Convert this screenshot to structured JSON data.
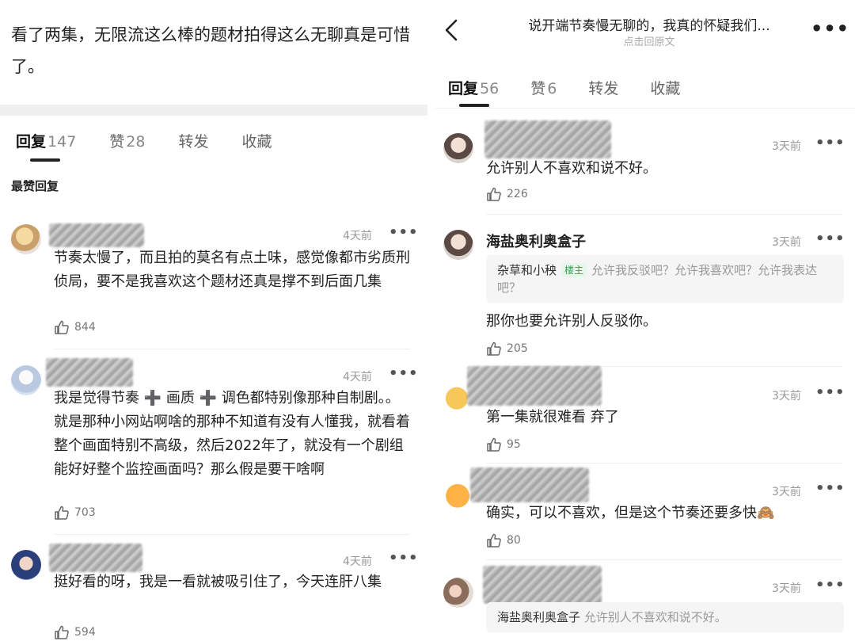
{
  "left": {
    "post_text": "看了两集，无限流这么棒的题材拍得这么无聊真是可惜了。",
    "tabs": [
      {
        "label": "回复",
        "count": "147"
      },
      {
        "label": "赞",
        "count": "28"
      },
      {
        "label": "转发",
        "count": ""
      },
      {
        "label": "收藏",
        "count": ""
      }
    ],
    "section_label": "最赞回复",
    "comments": [
      {
        "time": "4天前",
        "text": "节奏太慢了，而且拍的莫名有点土味，感觉像都市劣质刑侦局，要不是我喜欢这个题材还真是撑不到后面几集",
        "likes": "844"
      },
      {
        "time": "4天前",
        "text": "我是觉得节奏 ➕ 画质 ➕ 调色都特别像那种自制剧。。就是那种小网站啊啥的那种不知道有没有人懂我，就看着整个画面特别不高级，然后2022年了，就没有一个剧组能好好整个监控画面吗？那么假是要干啥啊",
        "likes": "703"
      },
      {
        "time": "4天前",
        "text": "挺好看的呀，我是一看就被吸引住了，今天连肝八集",
        "likes": "594"
      }
    ]
  },
  "right": {
    "header": {
      "title": "说开端节奏慢无聊的，我真的怀疑我们...",
      "subtitle": "点击回原文",
      "more": "•••"
    },
    "tabs": [
      {
        "label": "回复",
        "count": "56"
      },
      {
        "label": "赞",
        "count": "6"
      },
      {
        "label": "转发",
        "count": ""
      },
      {
        "label": "收藏",
        "count": ""
      }
    ],
    "comments": [
      {
        "name": "",
        "time": "3天前",
        "text": "允许别人不喜欢和说不好。",
        "likes": "226"
      },
      {
        "name": "海盐奥利奥盒子",
        "time": "3天前",
        "quote_name": "杂草和小秧",
        "quote_tag": "楼主",
        "quote_text": "允许我反驳吧？允许我喜欢吧？允许我表达吧？",
        "text": "那你也要允许别人反驳你。",
        "likes": "205"
      },
      {
        "name": "",
        "time": "3天前",
        "text": "第一集就很难看 弃了",
        "likes": "95"
      },
      {
        "name": "",
        "time": "3天前",
        "text": "确实，可以不喜欢，但是这个节奏还要多快🙈",
        "likes": "80"
      },
      {
        "name": "",
        "time": "3天前",
        "quote_name": "海盐奥利奥盒子",
        "quote_text": "允许别人不喜欢和说不好。"
      }
    ]
  },
  "colors": {
    "accent_green": "#2ea44f",
    "muted": "#999999",
    "band": "#f0f0f0"
  },
  "icons": [
    "back-chevron-icon",
    "more-dots-icon",
    "thumbs-up-icon",
    "avatar"
  ]
}
